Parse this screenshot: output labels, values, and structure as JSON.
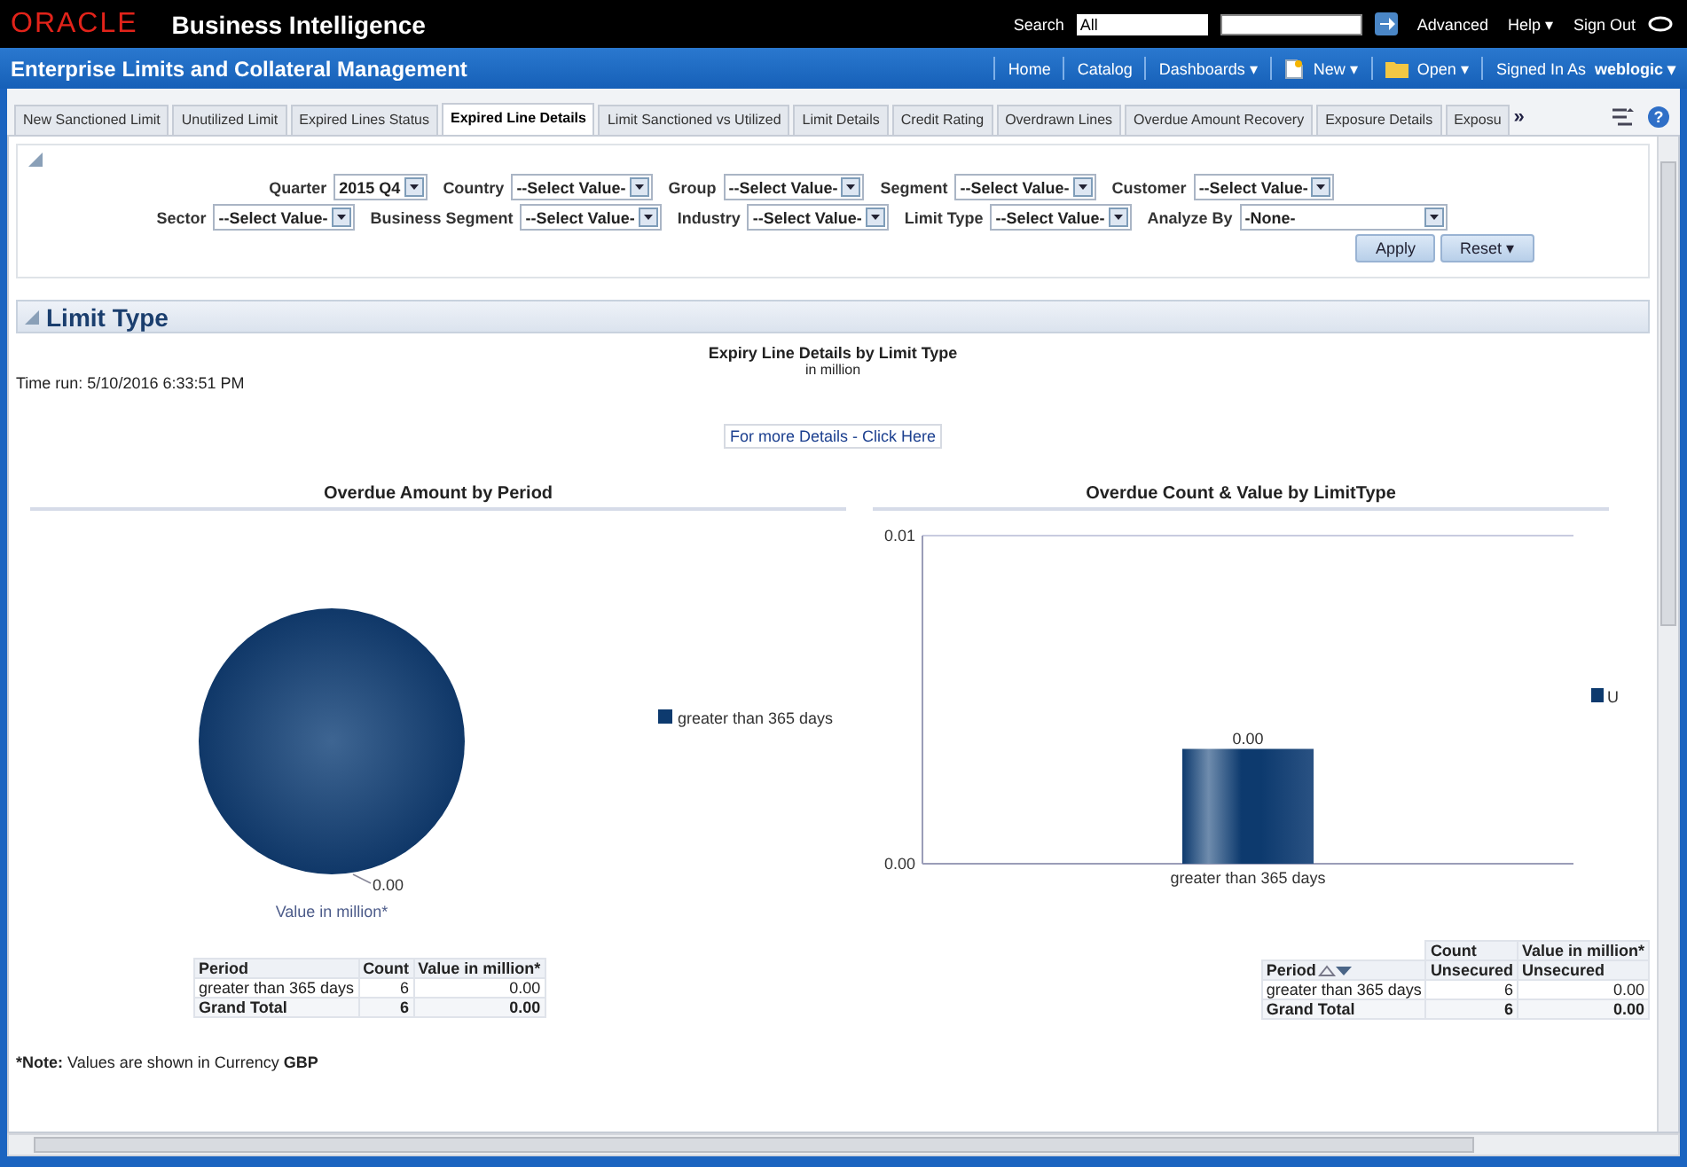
{
  "header": {
    "logo": "ORACLE",
    "product": "Business Intelligence",
    "search_label": "Search",
    "search_scope": "All",
    "links": [
      "Advanced",
      "Help ▾",
      "Sign Out"
    ]
  },
  "dashboard_bar": {
    "title": "Enterprise Limits and Collateral Management",
    "links": [
      {
        "label": "Home",
        "kind": "plain"
      },
      {
        "label": "Catalog",
        "kind": "plain"
      },
      {
        "label": "Dashboards ▾",
        "kind": "plain"
      },
      {
        "label": "New ▾",
        "kind": "new"
      },
      {
        "label": "Open ▾",
        "kind": "open"
      }
    ],
    "signed_in_label": "Signed In As",
    "user": "weblogic ▾"
  },
  "tabs": [
    {
      "label": "New Sanctioned Limit",
      "selected": false
    },
    {
      "label": "Unutilized Limit",
      "selected": false
    },
    {
      "label": "Expired Lines Status",
      "selected": false
    },
    {
      "label": "Expired Line Details",
      "selected": true
    },
    {
      "label": "Limit Sanctioned vs Utilized",
      "selected": false
    },
    {
      "label": "Limit Details",
      "selected": false
    },
    {
      "label": "Credit Rating",
      "selected": false
    },
    {
      "label": "Overdrawn Lines",
      "selected": false
    },
    {
      "label": "Overdue Amount Recovery",
      "selected": false
    },
    {
      "label": "Exposure Details",
      "selected": false
    },
    {
      "label": "Exposu",
      "selected": false
    }
  ],
  "tab_overflow": "»",
  "help": "?",
  "prompts": {
    "rows": [
      [
        {
          "label": "Quarter",
          "value": "2015 Q4",
          "wide": false
        },
        {
          "label": "Country",
          "value": "--Select Value-",
          "wide": false
        },
        {
          "label": "Group",
          "value": "--Select Value-",
          "wide": false
        },
        {
          "label": "Segment",
          "value": "--Select Value-",
          "wide": false
        },
        {
          "label": "Customer",
          "value": "--Select Value-",
          "wide": false
        }
      ],
      [
        {
          "label": "Sector",
          "value": "--Select Value-",
          "wide": false
        },
        {
          "label": "Business Segment",
          "value": "--Select Value-",
          "wide": false
        },
        {
          "label": "Industry",
          "value": "--Select Value-",
          "wide": false
        },
        {
          "label": "Limit Type",
          "value": "--Select Value-",
          "wide": false
        },
        {
          "label": "Analyze By",
          "value": "-None-",
          "wide": true
        }
      ]
    ],
    "buttons": [
      "Apply",
      "Reset ▾"
    ]
  },
  "section": {
    "title": "Limit Type",
    "report_title": "Expiry Line Details by Limit Type",
    "report_subtitle": "in million",
    "time_run": "Time run: 5/10/2016 6:33:51 PM",
    "details_link": "For more Details - Click Here"
  },
  "pie": {
    "title": "Overdue Amount by Period",
    "data_label": "0.00",
    "caption": "Value in million*",
    "legend": [
      "greater than 365 days"
    ]
  },
  "bar": {
    "title": "Overdue Count & Value by LimitType",
    "chart_data": {
      "type": "bar",
      "categories": [
        "greater than 365 days"
      ],
      "series": [
        {
          "name": "U",
          "color": "#0d3a6e",
          "values": [
            0.0035
          ]
        }
      ],
      "value_labels": [
        "0.00"
      ],
      "ylim": [
        0,
        0.01
      ],
      "yticks": [
        {
          "value": 0,
          "label": "0.00"
        },
        {
          "value": 0.01,
          "label": "0.01"
        }
      ]
    }
  },
  "left_table": {
    "columns": [
      "Period",
      "Count",
      "Value in million*"
    ],
    "rows": [
      {
        "cells": [
          "greater than 365 days",
          "6",
          "0.00"
        ],
        "total": false
      },
      {
        "cells": [
          "Grand Total",
          "6",
          "0.00"
        ],
        "total": true
      }
    ]
  },
  "right_table": {
    "group_header": [
      "Count",
      "Value in million*"
    ],
    "columns": [
      "Period",
      "Unsecured",
      "Unsecured"
    ],
    "rows": [
      {
        "cells": [
          "greater than 365 days",
          "6",
          "0.00"
        ],
        "total": false
      },
      {
        "cells": [
          "Grand Total",
          "6",
          "0.00"
        ],
        "total": true
      }
    ]
  },
  "note": {
    "label": "*Note:",
    "text": "Values are shown in Currency",
    "currency": "GBP"
  }
}
